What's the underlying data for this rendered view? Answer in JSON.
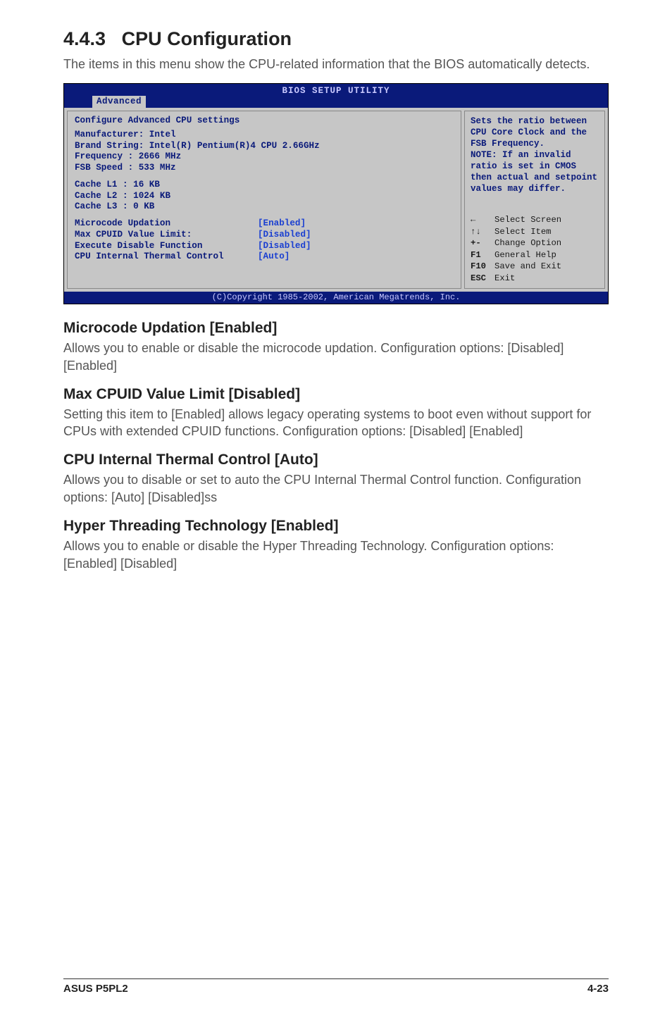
{
  "header": {
    "section_num": "4.4.3",
    "section_title": "CPU Configuration",
    "intro": "The items in this menu show the CPU-related information that the BIOS automatically detects."
  },
  "bios": {
    "title": "BIOS SETUP UTILITY",
    "tab": "Advanced",
    "config_header": "Configure Advanced CPU settings",
    "info": {
      "manufacturer": "Manufacturer: Intel",
      "brand": "Brand String: Intel(R) Pentium(R)4 CPU 2.66GHz",
      "frequency": "Frequency    : 2666 MHz",
      "fsb": "FSB Speed    : 533 MHz",
      "l1": "Cache L1     : 16 KB",
      "l2": "Cache L2     : 1024 KB",
      "l3": "Cache L3     : 0 KB"
    },
    "settings": [
      {
        "label": "Microcode Updation",
        "value": "[Enabled]"
      },
      {
        "label": "Max CPUID Value Limit:",
        "value": "[Disabled]"
      },
      {
        "label": "Execute Disable Function",
        "value": "[Disabled]"
      },
      {
        "label": "CPU Internal Thermal Control",
        "value": "[Auto]"
      }
    ],
    "help_text": "Sets the ratio between CPU Core Clock and the FSB Frequency.\nNOTE: If an invalid ratio is set in CMOS then actual and setpoint values may differ.",
    "nav": [
      {
        "key": "←",
        "label": "Select Screen"
      },
      {
        "key": "↑↓",
        "label": "Select Item"
      },
      {
        "key": "+-",
        "label": "Change Option"
      },
      {
        "key": "F1",
        "label": "General Help"
      },
      {
        "key": "F10",
        "label": "Save and Exit"
      },
      {
        "key": "ESC",
        "label": "Exit"
      }
    ],
    "copyright": "(C)Copyright 1985-2002, American Megatrends, Inc."
  },
  "content": {
    "microcode_h": "Microcode Updation [Enabled]",
    "microcode_p": "Allows you to enable or disable the microcode updation. Configuration options: [Disabled] [Enabled]",
    "cpuid_h": "Max CPUID Value Limit [Disabled]",
    "cpuid_p": "Setting this item to [Enabled] allows legacy operating systems to boot even without support for CPUs with extended CPUID functions. Configuration options: [Disabled] [Enabled]",
    "thermal_h": "CPU Internal Thermal Control [Auto]",
    "thermal_p": "Allows you to disable or set to auto the CPU Internal Thermal Control function. Configuration options: [Auto] [Disabled]ss",
    "ht_h": "Hyper Threading Technology [Enabled]",
    "ht_p": "Allows you to enable or disable the Hyper Threading Technology. Configuration options: [Enabled] [Disabled]"
  },
  "footer": {
    "left": "ASUS P5PL2",
    "right": "4-23"
  }
}
